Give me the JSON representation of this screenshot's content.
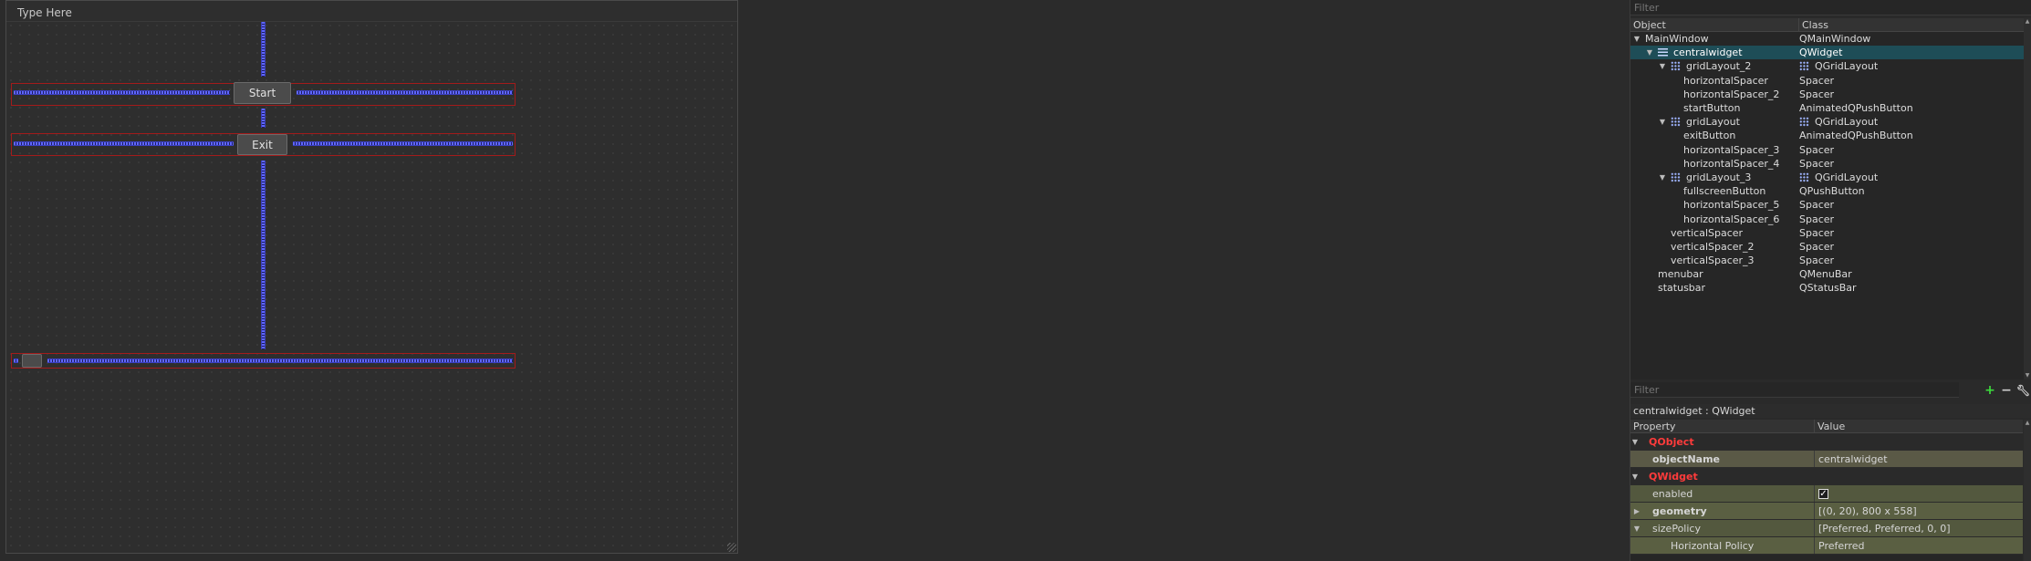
{
  "form": {
    "menu_placeholder": "Type Here",
    "start_label": "Start",
    "exit_label": "Exit"
  },
  "object_inspector": {
    "filter_placeholder": "Filter",
    "columns": [
      "Object",
      "Class"
    ],
    "rows": [
      {
        "object": "MainWindow",
        "class": "QMainWindow"
      },
      {
        "object": "centralwidget",
        "class": "QWidget"
      },
      {
        "object": "gridLayout_2",
        "class": "QGridLayout"
      },
      {
        "object": "horizontalSpacer",
        "class": "Spacer"
      },
      {
        "object": "horizontalSpacer_2",
        "class": "Spacer"
      },
      {
        "object": "startButton",
        "class": "AnimatedQPushButton"
      },
      {
        "object": "gridLayout",
        "class": "QGridLayout"
      },
      {
        "object": "exitButton",
        "class": "AnimatedQPushButton"
      },
      {
        "object": "horizontalSpacer_3",
        "class": "Spacer"
      },
      {
        "object": "horizontalSpacer_4",
        "class": "Spacer"
      },
      {
        "object": "gridLayout_3",
        "class": "QGridLayout"
      },
      {
        "object": "fullscreenButton",
        "class": "QPushButton"
      },
      {
        "object": "horizontalSpacer_5",
        "class": "Spacer"
      },
      {
        "object": "horizontalSpacer_6",
        "class": "Spacer"
      },
      {
        "object": "verticalSpacer",
        "class": "Spacer"
      },
      {
        "object": "verticalSpacer_2",
        "class": "Spacer"
      },
      {
        "object": "verticalSpacer_3",
        "class": "Spacer"
      },
      {
        "object": "menubar",
        "class": "QMenuBar"
      },
      {
        "object": "statusbar",
        "class": "QStatusBar"
      }
    ]
  },
  "property_editor": {
    "filter_placeholder": "Filter",
    "object_info": "centralwidget : QWidget",
    "columns": [
      "Property",
      "Value"
    ],
    "rows": [
      {
        "name": "QObject",
        "value": ""
      },
      {
        "name": "objectName",
        "value": "centralwidget"
      },
      {
        "name": "QWidget",
        "value": ""
      },
      {
        "name": "enabled",
        "value": "✓"
      },
      {
        "name": "geometry",
        "value": "[(0, 20), 800 x 558]"
      },
      {
        "name": "sizePolicy",
        "value": "[Preferred, Preferred, 0, 0]"
      },
      {
        "name": "Horizontal Policy",
        "value": "Preferred"
      }
    ]
  },
  "icons": {
    "add": "plus-icon",
    "remove": "minus-icon",
    "configure": "wrench-icon",
    "layout": "grid-layout-icon",
    "widget": "widget-icon"
  },
  "colors": {
    "selection": "#1e4d57",
    "category": "#ff3b3b",
    "spacer": "#5f67ff",
    "layout_border": "#a31b1b"
  }
}
